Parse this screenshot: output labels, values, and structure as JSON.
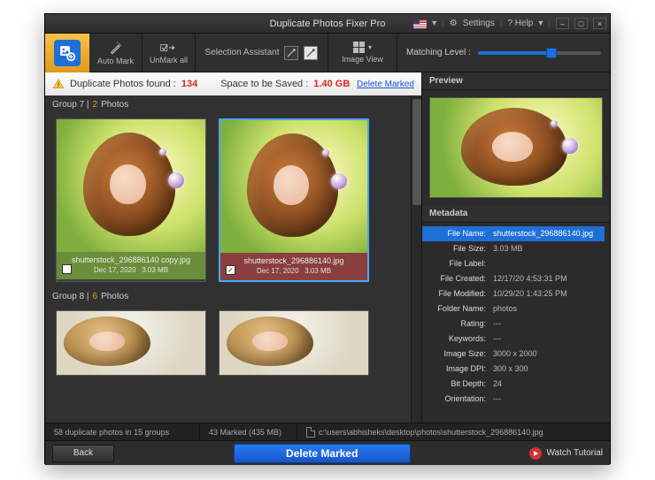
{
  "titlebar": {
    "title": "Duplicate Photos Fixer Pro",
    "settings": "Settings",
    "help": "? Help",
    "dropdown": "▾"
  },
  "toolbar": {
    "automark": "Auto Mark",
    "unmark": "UnMark all",
    "selection_assistant": "Selection Assistant",
    "image_view": "Image View",
    "matching_label": "Matching Level :",
    "matching_pct": 60
  },
  "summary": {
    "label1": "Duplicate Photos found :",
    "count": "134",
    "label2": "Space to be Saved :",
    "size": "1.40 GB",
    "delete_marked": "Delete Marked"
  },
  "groups": [
    {
      "title_a": "Group 7 |",
      "count": "2",
      "title_b": "Photos",
      "items": [
        {
          "filename": "shutterstock_296886140 copy.jpg",
          "date": "Dec 17, 2020",
          "size": "3.03 MB",
          "checked": false,
          "cap_class": "green",
          "selected": false
        },
        {
          "filename": "shutterstock_296886140.jpg",
          "date": "Dec 17, 2020",
          "size": "3.03 MB",
          "checked": true,
          "cap_class": "red",
          "selected": true
        }
      ]
    },
    {
      "title_a": "Group 8 |",
      "count": "6",
      "title_b": "Photos",
      "items": [
        {
          "alt": true
        },
        {
          "alt": true
        }
      ]
    }
  ],
  "preview": {
    "title": "Preview"
  },
  "metadata": {
    "title": "Metadata",
    "rows": [
      {
        "k": "File Name:",
        "v": "shutterstock_296886140.jpg",
        "sel": true
      },
      {
        "k": "File Size:",
        "v": "3.03 MB"
      },
      {
        "k": "File Label:",
        "v": ""
      },
      {
        "k": "File Created:",
        "v": "12/17/20 4:53:31 PM"
      },
      {
        "k": "File Modified:",
        "v": "10/29/20 1:43:25 PM"
      },
      {
        "k": "Folder Name:",
        "v": "photos"
      },
      {
        "k": "Rating:",
        "v": "---"
      },
      {
        "k": "Keywords:",
        "v": "---"
      },
      {
        "k": "Image Size:",
        "v": "3000 x 2000"
      },
      {
        "k": "Image DPI:",
        "v": "300 x 300"
      },
      {
        "k": "Bit Depth:",
        "v": "24"
      },
      {
        "k": "Orientation:",
        "v": "---"
      }
    ]
  },
  "status": {
    "left": "58 duplicate photos in 15 groups",
    "mid": "43 Marked (435 MB)",
    "path": "c:\\users\\abhisheks\\desktop\\photos\\shutterstock_296886140.jpg"
  },
  "bottom": {
    "back": "Back",
    "delete": "Delete Marked",
    "watch": "Watch Tutorial"
  }
}
